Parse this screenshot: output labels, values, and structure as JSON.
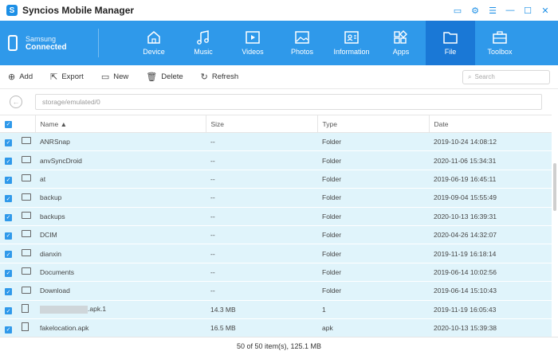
{
  "app": {
    "title": "Syncios Mobile Manager",
    "logo_letter": "S"
  },
  "device": {
    "name": "Samsung",
    "status": "Connected"
  },
  "tabs": [
    {
      "label": "Device",
      "icon": "home-icon"
    },
    {
      "label": "Music",
      "icon": "music-icon"
    },
    {
      "label": "Videos",
      "icon": "video-icon"
    },
    {
      "label": "Photos",
      "icon": "photo-icon"
    },
    {
      "label": "Information",
      "icon": "contact-icon"
    },
    {
      "label": "Apps",
      "icon": "apps-icon"
    },
    {
      "label": "File",
      "icon": "folder-icon",
      "active": true
    },
    {
      "label": "Toolbox",
      "icon": "toolbox-icon"
    }
  ],
  "toolbar": {
    "add": "Add",
    "export": "Export",
    "new": "New",
    "delete": "Delete",
    "refresh": "Refresh",
    "search_placeholder": "Search"
  },
  "path": {
    "placeholder": "storage/emulated/0"
  },
  "columns": {
    "name": "Name",
    "size": "Size",
    "type": "Type",
    "date": "Date"
  },
  "rows": [
    {
      "name": "ANRSnap",
      "size": "--",
      "type": "Folder",
      "date": "2019-10-24 14:08:12",
      "kind": "folder"
    },
    {
      "name": "anvSyncDroid",
      "size": "--",
      "type": "Folder",
      "date": "2020-11-06 15:34:31",
      "kind": "folder"
    },
    {
      "name": "at",
      "size": "--",
      "type": "Folder",
      "date": "2019-06-19 16:45:11",
      "kind": "folder"
    },
    {
      "name": "backup",
      "size": "--",
      "type": "Folder",
      "date": "2019-09-04 15:55:49",
      "kind": "folder"
    },
    {
      "name": "backups",
      "size": "--",
      "type": "Folder",
      "date": "2020-10-13 16:39:31",
      "kind": "folder"
    },
    {
      "name": "DCIM",
      "size": "--",
      "type": "Folder",
      "date": "2020-04-26 14:32:07",
      "kind": "folder"
    },
    {
      "name": "dianxin",
      "size": "--",
      "type": "Folder",
      "date": "2019-11-19 16:18:14",
      "kind": "folder"
    },
    {
      "name": "Documents",
      "size": "--",
      "type": "Folder",
      "date": "2019-06-14 10:02:56",
      "kind": "folder"
    },
    {
      "name": "Download",
      "size": "--",
      "type": "Folder",
      "date": "2019-06-14 15:10:43",
      "kind": "folder"
    },
    {
      "name": ".apk.1",
      "size": "14.3 MB",
      "type": "1",
      "date": "2019-11-19 16:05:43",
      "kind": "file",
      "blurred": true
    },
    {
      "name": "fakelocation.apk",
      "size": "16.5 MB",
      "type": "apk",
      "date": "2020-10-13 15:39:38",
      "kind": "file"
    }
  ],
  "status": "50 of 50 item(s), 125.1 MB"
}
